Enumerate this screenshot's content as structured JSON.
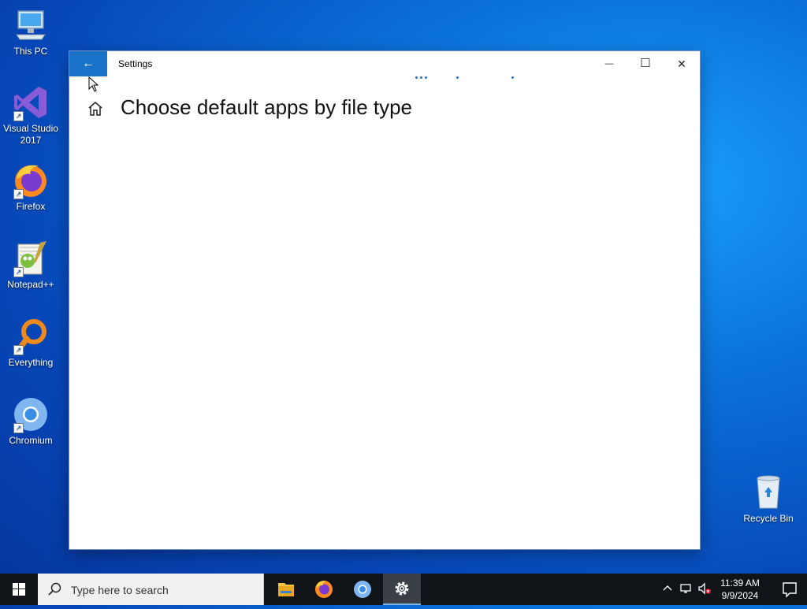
{
  "desktop": {
    "icons": [
      {
        "label": "This PC"
      },
      {
        "label": "Visual Studio 2017"
      },
      {
        "label": "Firefox"
      },
      {
        "label": "Notepad++"
      },
      {
        "label": "Everything"
      },
      {
        "label": "Chromium"
      },
      {
        "label": "Recycle Bin"
      }
    ]
  },
  "window": {
    "title": "Settings",
    "page_title": "Choose default apps by file type",
    "back_glyph": "←",
    "minimize_glyph": "—",
    "maximize_glyph": "☐",
    "close_glyph": "✕"
  },
  "taskbar": {
    "search_placeholder": "Type here to search",
    "time": "11:39 AM",
    "date": "9/9/2024"
  },
  "colors": {
    "accent": "#1a73c9",
    "taskbar": "#101418"
  }
}
